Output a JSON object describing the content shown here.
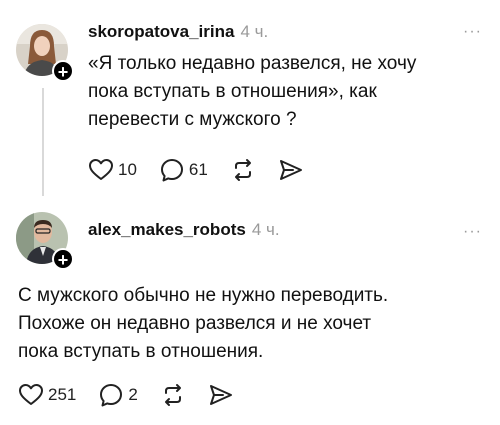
{
  "colors": {
    "text": "#111111",
    "muted": "#9a9a9a",
    "badge": "#000000"
  },
  "posts": [
    {
      "username": "skoropatova_irina",
      "time": "4 ч.",
      "more_label": "···",
      "text_lines": [
        "«Я только недавно развелся, не хочу",
        "пока вступать в отношения», как",
        "перевести с мужского ?"
      ],
      "likes": "10",
      "replies": "61",
      "icons": [
        "heart-icon",
        "comment-icon",
        "repost-icon",
        "share-icon"
      ]
    },
    {
      "username": "alex_makes_robots",
      "time": "4 ч.",
      "more_label": "···",
      "text_lines": [
        "С мужского обычно не нужно переводить.",
        "Похоже он недавно развелся и не хочет",
        "пока вступать в отношения."
      ],
      "likes": "251",
      "replies": "2",
      "icons": [
        "heart-icon",
        "comment-icon",
        "repost-icon",
        "share-icon"
      ]
    }
  ]
}
